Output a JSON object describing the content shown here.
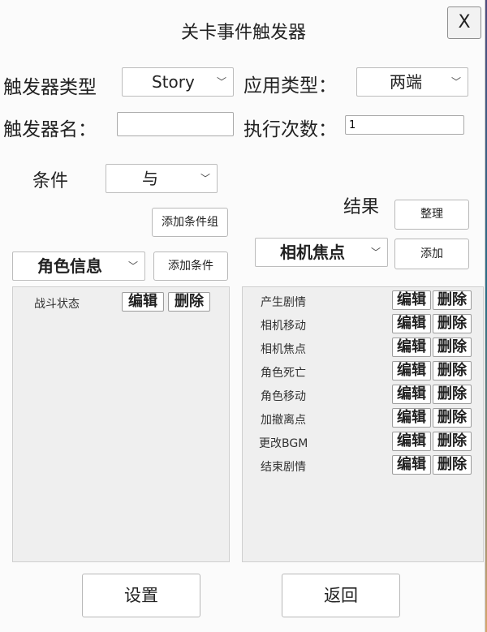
{
  "window": {
    "title": "关卡事件触发器",
    "close_label": "X"
  },
  "trigger": {
    "type_label": "触发器类型",
    "type_value": "Story",
    "apply_label": "应用类型：",
    "apply_value": "两端",
    "name_label": "触发器名：",
    "name_value": "",
    "count_label": "执行次数：",
    "count_value": "1"
  },
  "conditions": {
    "label": "条件",
    "logic_value": "与",
    "add_group_label": "添加条件组",
    "category_value": "角色信息",
    "add_label": "添加条件",
    "items": [
      {
        "name": "战斗状态",
        "edit": "编辑",
        "delete": "删除"
      }
    ]
  },
  "results": {
    "label": "结果",
    "organize_label": "整理",
    "category_value": "相机焦点",
    "add_label": "添加",
    "items": [
      {
        "name": "产生剧情",
        "edit": "编辑",
        "delete": "删除"
      },
      {
        "name": "相机移动",
        "edit": "编辑",
        "delete": "删除"
      },
      {
        "name": "相机焦点",
        "edit": "编辑",
        "delete": "删除"
      },
      {
        "name": "角色死亡",
        "edit": "编辑",
        "delete": "删除"
      },
      {
        "name": "角色移动",
        "edit": "编辑",
        "delete": "删除"
      },
      {
        "name": "加撤离点",
        "edit": "编辑",
        "delete": "删除"
      },
      {
        "name": "更改BGM",
        "edit": "编辑",
        "delete": "删除"
      },
      {
        "name": "结束剧情",
        "edit": "编辑",
        "delete": "删除"
      }
    ]
  },
  "footer": {
    "settings_label": "设置",
    "back_label": "返回"
  },
  "icons": {
    "chevron": "chevron-down-icon"
  }
}
